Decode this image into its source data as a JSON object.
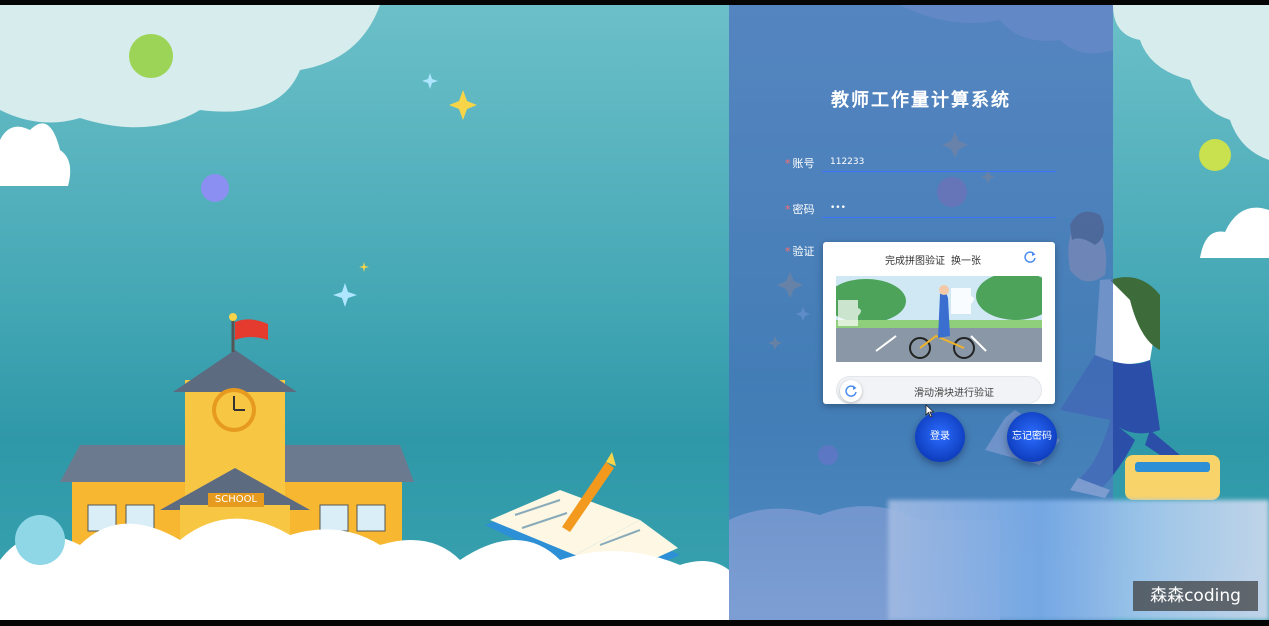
{
  "app": {
    "title": "教师工作量计算系统",
    "school_sign": "SCHOOL"
  },
  "form": {
    "account": {
      "required_mark": "*",
      "label": "账号",
      "value": "112233"
    },
    "password": {
      "required_mark": "*",
      "label": "密码",
      "value": "•••"
    },
    "captcha": {
      "required_mark": "*",
      "label": "验证"
    }
  },
  "captcha_popup": {
    "title": "完成拼图验证",
    "change_link": "换一张",
    "refresh_icon": "refresh-icon",
    "slider_hint": "滑动滑块进行验证",
    "slider_icon": "refresh-icon"
  },
  "buttons": {
    "login": "登录",
    "forgot": "忘记密码"
  },
  "watermark": "森森coding",
  "colors": {
    "panel": "#4f78be",
    "button": "#1a4fd8",
    "input_underline": "#3a74ff",
    "background": "#47a9b6"
  }
}
